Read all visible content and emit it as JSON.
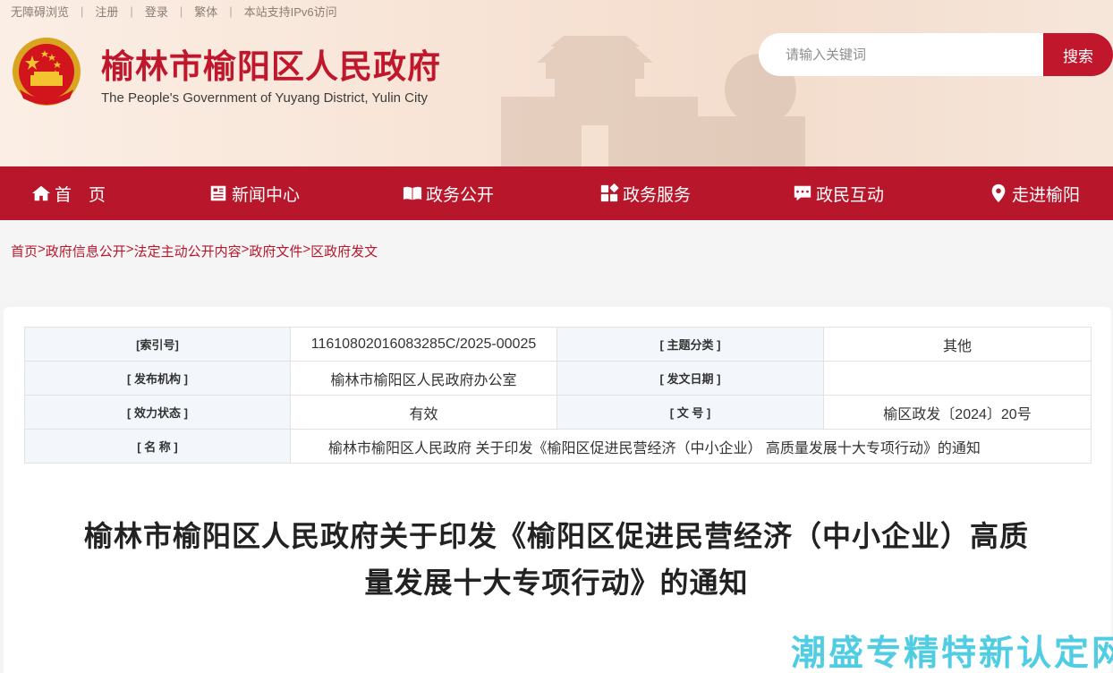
{
  "toplinks": [
    "无障碍浏览",
    "注册",
    "登录",
    "繁体",
    "本站支持IPv6访问"
  ],
  "site": {
    "title": "榆林市榆阳区人民政府",
    "subtitle": "The People's Government of Yuyang District, Yulin City"
  },
  "search": {
    "placeholder": "请输入关键词",
    "button": "搜索"
  },
  "nav": [
    {
      "label": "首　页",
      "icon": "home-icon"
    },
    {
      "label": "新闻中心",
      "icon": "news-icon"
    },
    {
      "label": "政务公开",
      "icon": "book-icon"
    },
    {
      "label": "政务服务",
      "icon": "grid-icon"
    },
    {
      "label": "政民互动",
      "icon": "chat-icon"
    },
    {
      "label": "走进榆阳",
      "icon": "location-pin-icon"
    }
  ],
  "breadcrumb": [
    "首页",
    "政府信息公开",
    "法定主动公开内容",
    "政府文件",
    "区政府发文"
  ],
  "meta": {
    "index_label": "[索引号]",
    "index_value": "11610802016083285C/2025-00025",
    "topic_label": "[ 主题分类 ]",
    "topic_value": "其他",
    "publisher_label": "[ 发布机构 ]",
    "publisher_value": "榆林市榆阳区人民政府办公室",
    "date_label": "[ 发文日期 ]",
    "date_value": "",
    "status_label": "[ 效力状态 ]",
    "status_value": "有效",
    "docno_label": "[ 文 号 ]",
    "docno_value": "榆区政发〔2024〕20号",
    "name_label": "[ 名 称 ]",
    "name_value": "榆林市榆阳区人民政府 关于印发《榆阳区促进民营经济（中小企业） 高质量发展十大专项行动》的通知"
  },
  "document": {
    "title_line1": "榆林市榆阳区人民政府关于印发《榆阳区促进民营经济（中小企业）高质",
    "title_line2": "量发展十大专项行动》的通知"
  },
  "watermark": "潮盛专精特新认定网",
  "colors": {
    "brand_red": "#b8172b",
    "header_bg": "#f7e3d5",
    "watermark": "#32c5de"
  }
}
